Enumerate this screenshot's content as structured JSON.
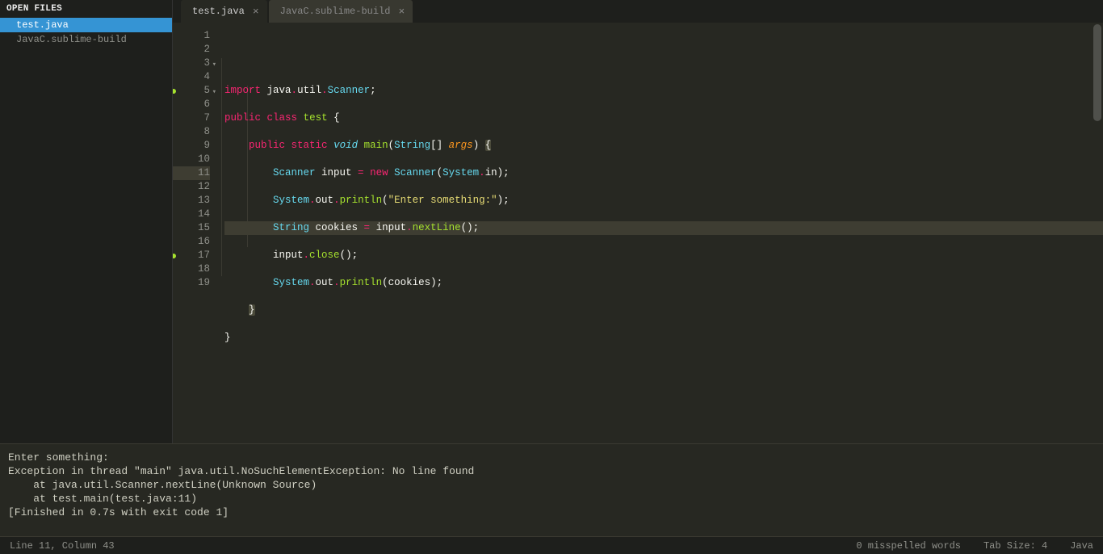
{
  "sidebar": {
    "header": "OPEN FILES",
    "items": [
      {
        "label": "test.java",
        "active": true
      },
      {
        "label": "JavaC.sublime-build",
        "active": false
      }
    ]
  },
  "tabs": [
    {
      "label": "test.java",
      "active": true
    },
    {
      "label": "JavaC.sublime-build",
      "active": false
    }
  ],
  "gutter": {
    "count": 19,
    "marks": [
      5,
      17
    ],
    "folds": [
      3,
      5
    ],
    "highlighted": 11
  },
  "code": [
    [
      [
        "kw",
        "import"
      ],
      [
        "plain",
        " "
      ],
      [
        "plain",
        "java"
      ],
      [
        "op",
        "."
      ],
      [
        "plain",
        "util"
      ],
      [
        "op",
        "."
      ],
      [
        "type2",
        "Scanner"
      ],
      [
        "plain",
        ";"
      ]
    ],
    [],
    [
      [
        "kw",
        "public"
      ],
      [
        "plain",
        " "
      ],
      [
        "kw",
        "class"
      ],
      [
        "plain",
        " "
      ],
      [
        "fn",
        "test"
      ],
      [
        "plain",
        " {"
      ]
    ],
    [],
    [
      [
        "plain",
        "    "
      ],
      [
        "kw",
        "public"
      ],
      [
        "plain",
        " "
      ],
      [
        "kw",
        "static"
      ],
      [
        "plain",
        " "
      ],
      [
        "type",
        "void"
      ],
      [
        "plain",
        " "
      ],
      [
        "fn",
        "main"
      ],
      [
        "plain",
        "("
      ],
      [
        "type2",
        "String"
      ],
      [
        "plain",
        "[] "
      ],
      [
        "var",
        "args"
      ],
      [
        "plain",
        ") "
      ],
      [
        "brace",
        "{"
      ]
    ],
    [],
    [
      [
        "plain",
        "        "
      ],
      [
        "type2",
        "Scanner"
      ],
      [
        "plain",
        " input "
      ],
      [
        "op",
        "="
      ],
      [
        "plain",
        " "
      ],
      [
        "kw",
        "new"
      ],
      [
        "plain",
        " "
      ],
      [
        "type2",
        "Scanner"
      ],
      [
        "plain",
        "("
      ],
      [
        "type2",
        "System"
      ],
      [
        "op",
        "."
      ],
      [
        "plain",
        "in);"
      ]
    ],
    [],
    [
      [
        "plain",
        "        "
      ],
      [
        "type2",
        "System"
      ],
      [
        "op",
        "."
      ],
      [
        "plain",
        "out"
      ],
      [
        "op",
        "."
      ],
      [
        "fn",
        "println"
      ],
      [
        "plain",
        "("
      ],
      [
        "str",
        "\"Enter something:\""
      ],
      [
        "plain",
        ");"
      ]
    ],
    [],
    [
      [
        "plain",
        "        "
      ],
      [
        "type2",
        "String"
      ],
      [
        "plain",
        " cookies "
      ],
      [
        "op",
        "="
      ],
      [
        "plain",
        " input"
      ],
      [
        "op",
        "."
      ],
      [
        "fn",
        "nextLine"
      ],
      [
        "plain",
        "();"
      ]
    ],
    [],
    [
      [
        "plain",
        "        input"
      ],
      [
        "op",
        "."
      ],
      [
        "fn",
        "close"
      ],
      [
        "plain",
        "();"
      ]
    ],
    [],
    [
      [
        "plain",
        "        "
      ],
      [
        "type2",
        "System"
      ],
      [
        "op",
        "."
      ],
      [
        "plain",
        "out"
      ],
      [
        "op",
        "."
      ],
      [
        "fn",
        "println"
      ],
      [
        "plain",
        "(cookies);"
      ]
    ],
    [],
    [
      [
        "plain",
        "    "
      ],
      [
        "brace",
        "}"
      ]
    ],
    [],
    [
      [
        "plain",
        "}"
      ]
    ]
  ],
  "console_lines": [
    "Enter something:",
    "Exception in thread \"main\" java.util.NoSuchElementException: No line found",
    "    at java.util.Scanner.nextLine(Unknown Source)",
    "    at test.main(test.java:11)",
    "[Finished in 0.7s with exit code 1]"
  ],
  "status": {
    "position": "Line 11, Column 43",
    "misspelled": "0 misspelled words",
    "tab_size": "Tab Size: 4",
    "language": "Java"
  }
}
